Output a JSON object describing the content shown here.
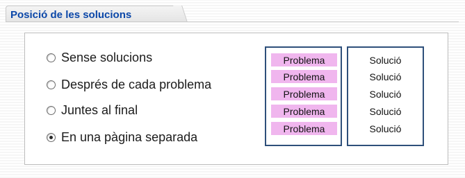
{
  "section": {
    "title": "Posició de les solucions"
  },
  "options": [
    {
      "label": "Sense solucions",
      "checked": false
    },
    {
      "label": "Després de cada problema",
      "checked": false
    },
    {
      "label": "Juntes al final",
      "checked": false
    },
    {
      "label": "En una pàgina separada",
      "checked": true
    }
  ],
  "preview": {
    "problems": [
      "Problema",
      "Problema",
      "Problema",
      "Problema",
      "Problema"
    ],
    "solutions": [
      "Solució",
      "Solució",
      "Solució",
      "Solució",
      "Solució"
    ],
    "problem_highlight_color": "#f0b6ee",
    "box_border_color": "#2e4f7a"
  },
  "colors": {
    "title": "#0b47a8"
  }
}
